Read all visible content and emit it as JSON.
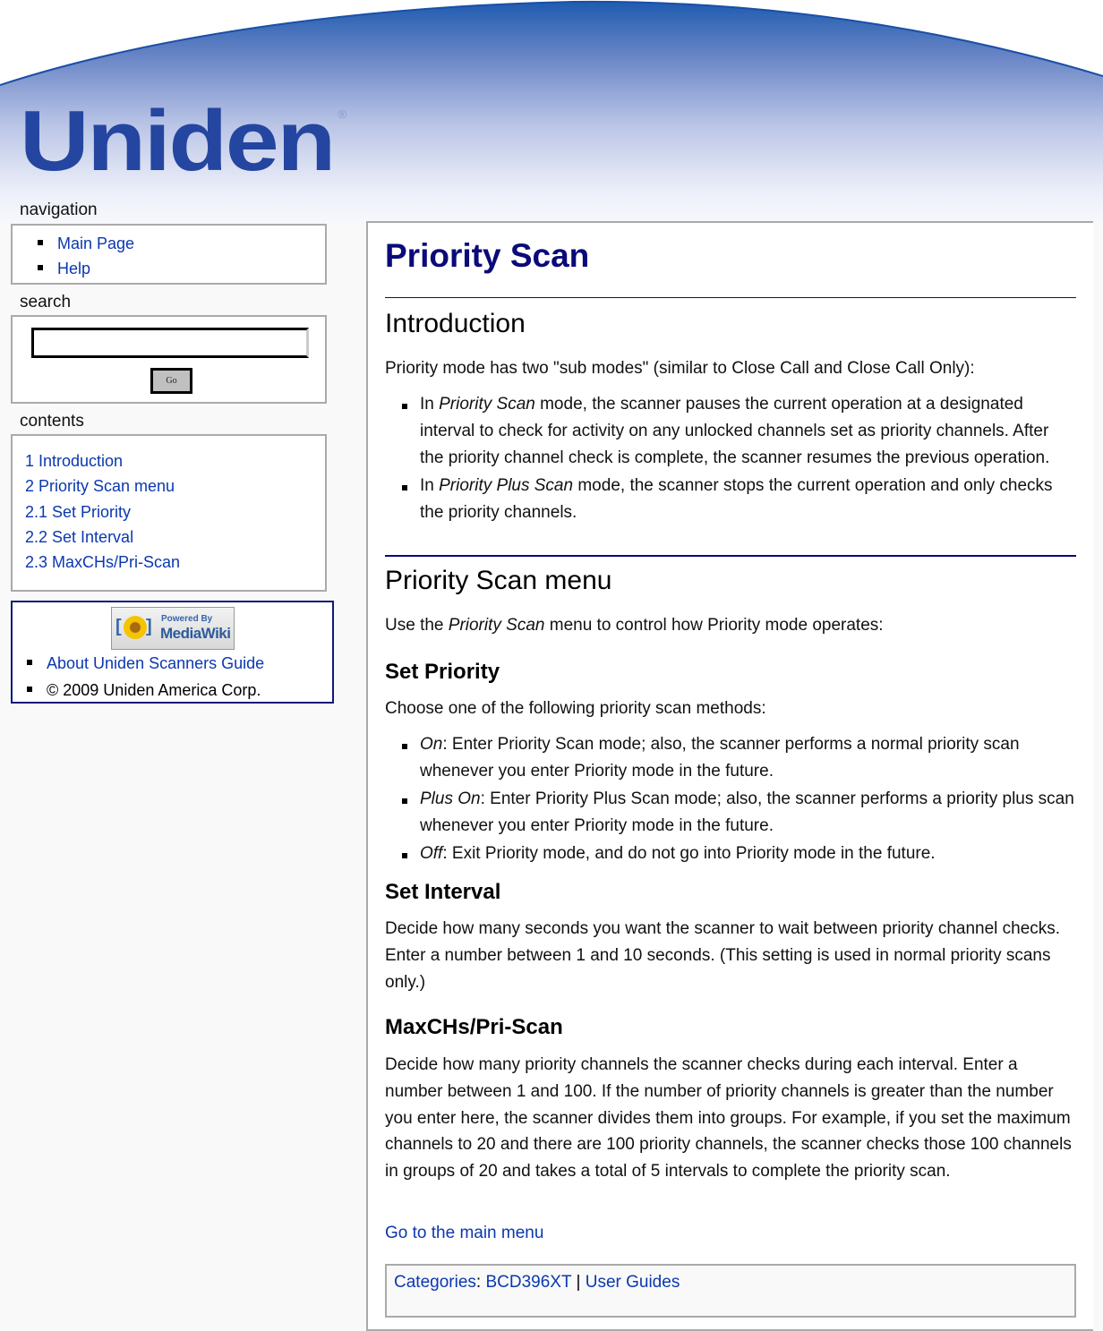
{
  "brand": {
    "logo_text": "Uniden",
    "logo_mark": "®",
    "colors": {
      "logo_blue": "#2446a0",
      "heading_navy": "#0a0a7a",
      "link_blue": "#0b38b0",
      "banner_blue": "#1f5bb0"
    }
  },
  "sidebar": {
    "navigation": {
      "title": "navigation",
      "items": [
        {
          "label": "Main Page"
        },
        {
          "label": "Help"
        }
      ]
    },
    "search": {
      "title": "search",
      "input_value": "",
      "go_label": "Go"
    },
    "contents": {
      "title": "contents",
      "items": [
        {
          "label": "1 Introduction"
        },
        {
          "label": "2 Priority Scan menu"
        },
        {
          "label": "2.1 Set Priority"
        },
        {
          "label": "2.2 Set Interval"
        },
        {
          "label": "2.3 MaxCHs/Pri-Scan"
        }
      ]
    },
    "footer": {
      "badge": {
        "line1": "Powered By",
        "line2": "MediaWiki",
        "icon": "mediawiki-sunflower-icon"
      },
      "about_link": "About Uniden Scanners Guide",
      "copyright": "© 2009 Uniden America Corp."
    }
  },
  "article": {
    "title": "Priority Scan",
    "sections": {
      "introduction": {
        "heading": "Introduction",
        "intro": "Priority mode has two \"sub modes\" (similar to Close Call and Close Call Only):",
        "bullets": [
          {
            "prefix": "In ",
            "em": "Priority Scan",
            "text": " mode, the scanner pauses the current operation at a designated interval to check for activity on any unlocked channels set as priority channels. After the priority channel check is complete, the scanner resumes the previous operation."
          },
          {
            "prefix": "In ",
            "em": "Priority Plus Scan",
            "text": " mode, the scanner stops the current operation and only checks the priority channels."
          }
        ]
      },
      "menu": {
        "heading": "Priority Scan menu",
        "intro_prefix": "Use the ",
        "intro_em": "Priority Scan",
        "intro_suffix": " menu to control how Priority mode operates:"
      },
      "set_priority": {
        "heading": "Set Priority",
        "intro": "Choose one of the following priority scan methods:",
        "bullets": [
          {
            "em": "On",
            "text": ": Enter Priority Scan mode; also, the scanner performs a normal priority scan whenever you enter Priority mode in the future."
          },
          {
            "em": "Plus On",
            "text": ": Enter Priority Plus Scan mode; also, the scanner performs a priority plus scan whenever you enter Priority mode in the future."
          },
          {
            "em": "Off",
            "text": ": Exit Priority mode, and do not go into Priority mode in the future."
          }
        ]
      },
      "set_interval": {
        "heading": "Set Interval",
        "text": "Decide how many seconds you want the scanner to wait between priority channel checks. Enter a number between 1 and 10 seconds. (This setting is used in normal priority scans only.)"
      },
      "maxchs": {
        "heading": "MaxCHs/Pri-Scan",
        "text": "Decide how many priority channels the scanner checks during each interval. Enter a number between 1 and 100. If the number of priority channels is greater than the number you enter here, the scanner divides them into groups. For example, if you set the maximum channels to 20 and there are 100 priority channels, the scanner checks those 100 channels in groups of 20 and takes a total of 5 intervals to complete the priority scan."
      }
    },
    "main_menu_link": "Go to the main menu",
    "categories": {
      "label": "Categories",
      "separator_colon": ":",
      "items": [
        "BCD396XT",
        "User Guides"
      ],
      "separator": "|"
    }
  }
}
